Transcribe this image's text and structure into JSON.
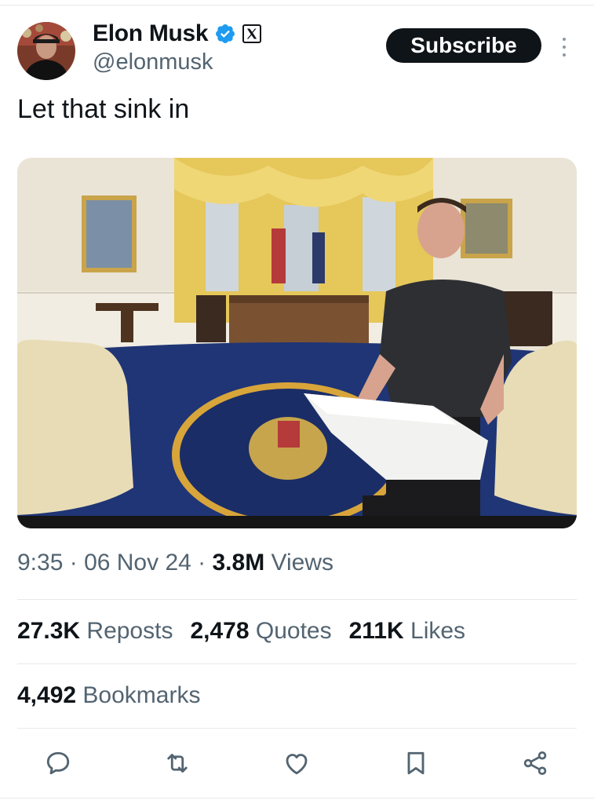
{
  "author": {
    "name": "Elon Musk",
    "handle": "@elonmusk",
    "verified_icon": "verified-badge-icon",
    "affiliate_icon": "x-logo-icon"
  },
  "subscribe_label": "Subscribe",
  "more_icon": "more-vertical-icon",
  "tweet": {
    "text": "Let that sink in"
  },
  "media": {
    "description_icon": "photo"
  },
  "meta": {
    "time": "9:35",
    "sep1": " · ",
    "date": "06 Nov 24",
    "sep2": " · ",
    "views_count": "3.8M",
    "views_label": " Views"
  },
  "stats": {
    "reposts_count": "27.3K",
    "reposts_label": " Reposts",
    "quotes_count": "2,478",
    "quotes_label": " Quotes",
    "likes_count": "211K",
    "likes_label": " Likes",
    "bookmarks_count": "4,492",
    "bookmarks_label": " Bookmarks"
  },
  "actions": [
    "reply-icon",
    "repost-icon",
    "like-icon",
    "bookmark-icon",
    "share-icon"
  ],
  "colors": {
    "text": "#0f1419",
    "secondary": "#536471",
    "verified": "#1d9bf0",
    "divider": "#e6e9ec"
  }
}
